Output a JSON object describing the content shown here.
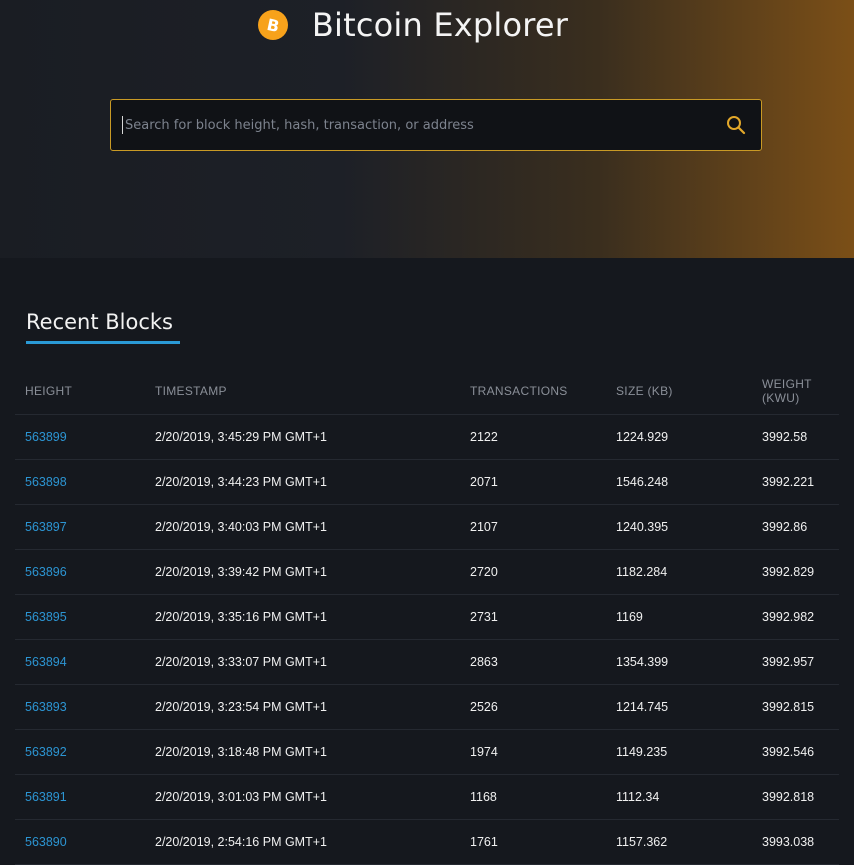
{
  "header": {
    "logo_glyph": "B",
    "title": "Bitcoin Explorer",
    "accent_color": "#f7a21b"
  },
  "search": {
    "placeholder": "Search for block height, hash, transaction, or address",
    "icon": "search-icon",
    "border_color": "#c99a25"
  },
  "section": {
    "title": "Recent Blocks",
    "underline_color": "#2a9ad6"
  },
  "table": {
    "columns": [
      "HEIGHT",
      "TIMESTAMP",
      "TRANSACTIONS",
      "SIZE (KB)",
      "WEIGHT (KWU)"
    ],
    "rows": [
      {
        "height": "563899",
        "timestamp": "2/20/2019, 3:45:29 PM GMT+1",
        "transactions": "2122",
        "size": "1224.929",
        "weight": "3992.58"
      },
      {
        "height": "563898",
        "timestamp": "2/20/2019, 3:44:23 PM GMT+1",
        "transactions": "2071",
        "size": "1546.248",
        "weight": "3992.221"
      },
      {
        "height": "563897",
        "timestamp": "2/20/2019, 3:40:03 PM GMT+1",
        "transactions": "2107",
        "size": "1240.395",
        "weight": "3992.86"
      },
      {
        "height": "563896",
        "timestamp": "2/20/2019, 3:39:42 PM GMT+1",
        "transactions": "2720",
        "size": "1182.284",
        "weight": "3992.829"
      },
      {
        "height": "563895",
        "timestamp": "2/20/2019, 3:35:16 PM GMT+1",
        "transactions": "2731",
        "size": "1169",
        "weight": "3992.982"
      },
      {
        "height": "563894",
        "timestamp": "2/20/2019, 3:33:07 PM GMT+1",
        "transactions": "2863",
        "size": "1354.399",
        "weight": "3992.957"
      },
      {
        "height": "563893",
        "timestamp": "2/20/2019, 3:23:54 PM GMT+1",
        "transactions": "2526",
        "size": "1214.745",
        "weight": "3992.815"
      },
      {
        "height": "563892",
        "timestamp": "2/20/2019, 3:18:48 PM GMT+1",
        "transactions": "1974",
        "size": "1149.235",
        "weight": "3992.546"
      },
      {
        "height": "563891",
        "timestamp": "2/20/2019, 3:01:03 PM GMT+1",
        "transactions": "1168",
        "size": "1112.34",
        "weight": "3992.818"
      },
      {
        "height": "563890",
        "timestamp": "2/20/2019, 2:54:16 PM GMT+1",
        "transactions": "1761",
        "size": "1157.362",
        "weight": "3993.038"
      }
    ]
  }
}
